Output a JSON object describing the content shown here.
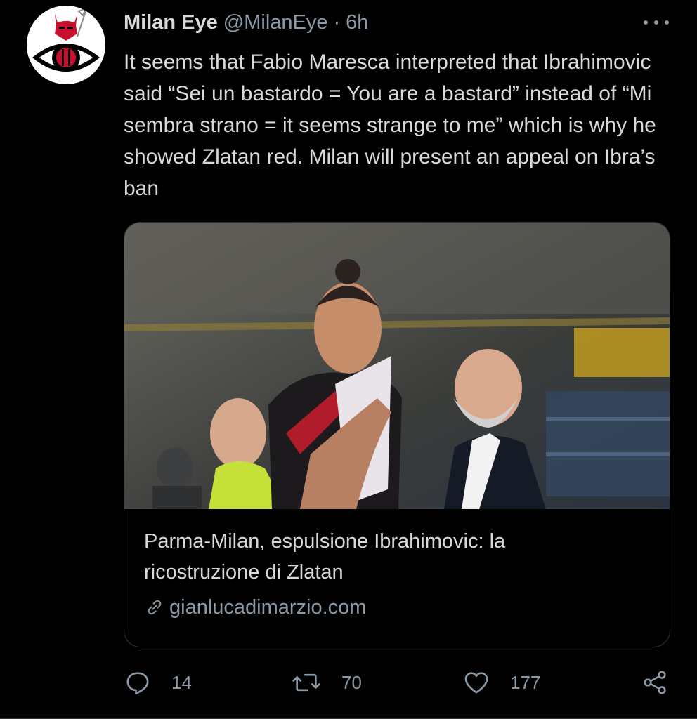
{
  "tweet": {
    "display_name": "Milan Eye",
    "handle": "@MilanEye",
    "separator": "·",
    "time": "6h",
    "text": "It seems that Fabio Maresca interpreted that Ibrahimovic said “Sei un bastardo = You are a bastard” instead of “Mi sembra strano = it seems strange to me” which is why he showed Zlatan red. Milan will present an appeal on Ibra’s ban"
  },
  "card": {
    "title": "Parma-Milan, espulsione Ibrahimovic: la ricostruzione di Zlatan",
    "domain": "gianlucadimarzio.com"
  },
  "actions": {
    "replies": "14",
    "retweets": "70",
    "likes": "177"
  },
  "icons": {
    "reply": "reply-icon",
    "retweet": "retweet-icon",
    "like": "heart-icon",
    "share": "share-icon",
    "link": "link-icon",
    "more": "more-icon"
  },
  "colors": {
    "background": "#000000",
    "text": "#d9d9d9",
    "secondary": "#8b98a5",
    "border": "#2f3336",
    "avatar_red": "#c8102e"
  }
}
